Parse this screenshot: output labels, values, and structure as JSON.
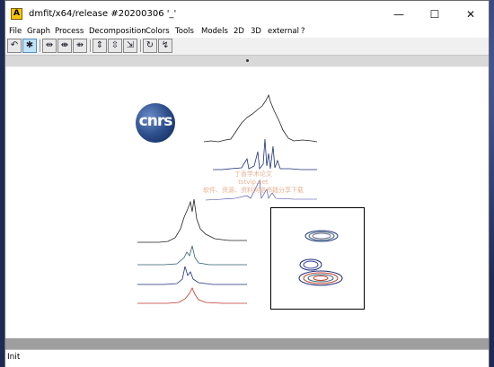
{
  "window": {
    "title": "dmfit/x64/release #20200306 '_'",
    "icon_letter": "A"
  },
  "window_controls": {
    "minimize": "—",
    "maximize": "☐",
    "close": "✕"
  },
  "menu": {
    "items": [
      "File",
      "Graph",
      "Process",
      "Decomposition",
      "Colors",
      "Tools",
      "Models",
      "2D",
      "3D",
      "external",
      "?"
    ]
  },
  "toolbar": {
    "buttons": [
      "undo-icon",
      "grid-icon",
      "fit-width-icon",
      "expand-h-icon",
      "contract-h-icon",
      "fit-height-icon",
      "expand-v-icon",
      "contract-v-icon",
      "rotate-icon",
      "spectrum-icon"
    ]
  },
  "canvas": {
    "logo_text": "cnrs",
    "watermark_line1": "丁香学术论文",
    "watermark_line2": "软件、资源、资料网络书籍分享下载",
    "watermark_url": "tstvip.net"
  },
  "status": {
    "text": "Init"
  },
  "colors": {
    "navy": "#1f2f7a",
    "red": "#c0392b",
    "teal": "#2c5f6b",
    "black": "#222222"
  }
}
